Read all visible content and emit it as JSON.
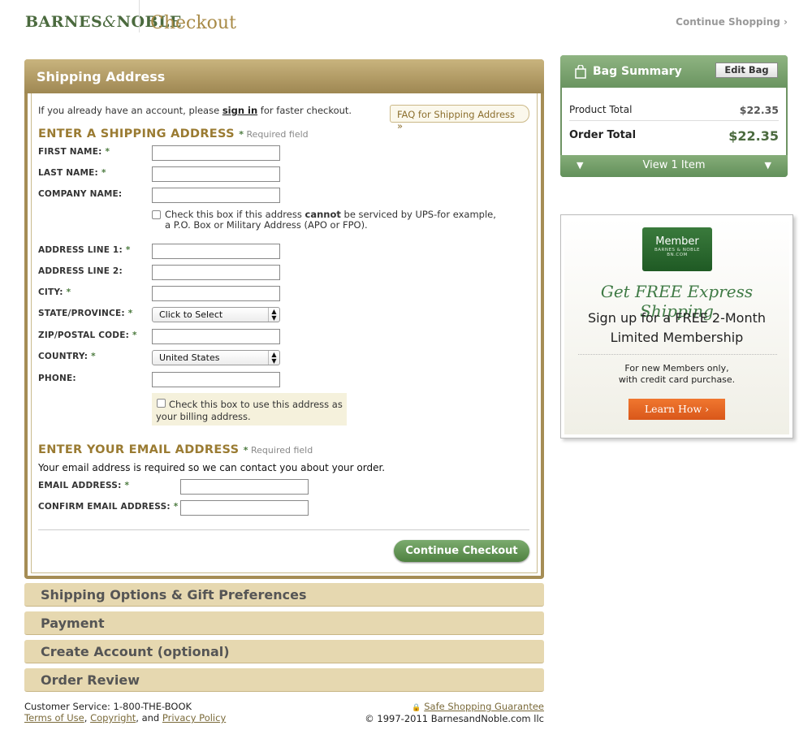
{
  "header": {
    "logo_text_1": "BARNES",
    "logo_amp": "&",
    "logo_text_2": "NOBLE",
    "title": "Checkout",
    "continue_shopping": "Continue Shopping ›"
  },
  "shipping": {
    "panel_title": "Shipping Address",
    "intro_pre": "If you already have an account, please ",
    "intro_link": "sign in",
    "intro_post": " for faster checkout.",
    "faq": "FAQ for Shipping Address  »",
    "section_title": "ENTER A SHIPPING ADDRESS",
    "required_star": "*",
    "required_text": " Required field",
    "fields": {
      "first_name": "FIRST NAME:",
      "last_name": "LAST NAME:",
      "company": "COMPANY NAME:",
      "addr1": "ADDRESS LINE 1:",
      "addr2": "ADDRESS LINE 2:",
      "city": "CITY:",
      "state": "STATE/PROVINCE:",
      "zip": "ZIP/POSTAL CODE:",
      "country": "COUNTRY:",
      "phone": "PHONE:"
    },
    "star": "*",
    "ups_check_pre": "Check this box if this address ",
    "ups_check_bold": "cannot",
    "ups_check_post": " be serviced by UPS-for example,",
    "ups_check_line2": "a P.O. Box or Military Address (APO or FPO).",
    "state_value": "Click to Select",
    "country_value": "United States",
    "billing_line1": "Check this box to use this address as",
    "billing_line2": "your billing address."
  },
  "email": {
    "section_title": "ENTER YOUR EMAIL ADDRESS",
    "note": "Your email address is required so we can contact you about your order.",
    "email_label": "EMAIL ADDRESS:",
    "confirm_label": "CONFIRM EMAIL ADDRESS:"
  },
  "continue_checkout": "Continue Checkout",
  "steps": [
    "Shipping Options & Gift Preferences",
    "Payment",
    "Create Account (optional)",
    "Order Review"
  ],
  "footer": {
    "customer_service": "Customer Service: 1-800-THE-BOOK",
    "terms": "Terms of Use",
    "copyright_link": "Copyright",
    "and": ", and ",
    "privacy": "Privacy Policy",
    "comma": ", ",
    "safe": "Safe Shopping Guarantee",
    "copyright": "© 1997-2011 BarnesandNoble.com llc"
  },
  "bag": {
    "title": "Bag Summary",
    "edit": "Edit Bag",
    "product_total_label": "Product Total",
    "product_total": "$22.35",
    "order_total_label": "Order Total",
    "order_total": "$22.35",
    "view_items": "View 1 Item"
  },
  "promo": {
    "card_line1": "Member",
    "card_line2": "BARNES & NOBLE",
    "card_line3": "BN.COM",
    "headline": "Get FREE Express Shipping",
    "sub1": "Sign up for a FREE 2-Month",
    "sub2": "Limited Membership",
    "note1": "For new Members only,",
    "note2": "with credit card purchase.",
    "cta": "Learn How ›"
  }
}
